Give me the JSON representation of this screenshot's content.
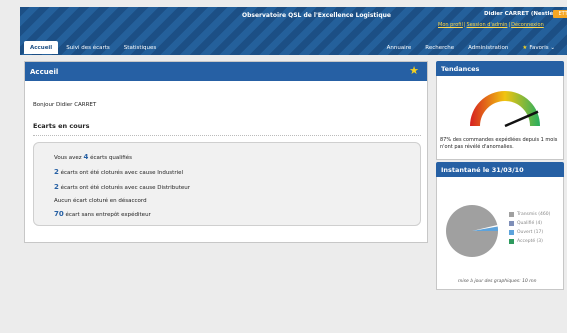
{
  "header": {
    "title": "Observatoire QSL de l'Excellence Logistique",
    "user_name": "Didier CARRET (Nestlé)",
    "user_badge": "ETTD",
    "links": [
      "Mon profil",
      "Session d'admin",
      "Déconnexion"
    ]
  },
  "tabs_left": [
    {
      "label": "Accueil",
      "active": true
    },
    {
      "label": "Suivi des écarts",
      "active": false
    },
    {
      "label": "Statistiques",
      "active": false
    }
  ],
  "tabs_right": [
    {
      "label": "Annuaire"
    },
    {
      "label": "Recherche"
    },
    {
      "label": "Administration"
    },
    {
      "label": "Favoris ⌄",
      "icon": "star-icon"
    }
  ],
  "main": {
    "title": "Accueil",
    "greeting": "Bonjour Didier CARRET",
    "section_title": "Ecarts en cours",
    "lines": [
      {
        "pre": "Vous avez ",
        "num": "4",
        "post": " écarts qualifiés"
      },
      {
        "pre": "",
        "num": "2",
        "post": " écarts ont été cloturés avec cause Industriel"
      },
      {
        "pre": "",
        "num": "2",
        "post": " écarts ont été cloturés avec cause Distributeur"
      },
      {
        "pre": "Aucun écart cloturé en désaccord",
        "num": "",
        "post": ""
      },
      {
        "pre": "",
        "num": "70",
        "post": " écart sans entrepôt expéditeur"
      }
    ]
  },
  "tendances": {
    "title": "Tendances",
    "gauge_level": 0.87,
    "text": "87% des commandes expédiées depuis 1 mois n'ont pas révélé d'anomalies."
  },
  "instantane": {
    "title": "Instantané le 31/03/10",
    "legend": [
      {
        "label": "Transmis (460)",
        "color": "#a0a0a0"
      },
      {
        "label": "Qualifié (4)",
        "color": "#7f8fb8"
      },
      {
        "label": "Ouvert (17)",
        "color": "#5da3dc"
      },
      {
        "label": "Accepté (3)",
        "color": "#2e9a5e"
      }
    ],
    "update_note": "mise à jour des graphiques: 10 mn"
  }
}
